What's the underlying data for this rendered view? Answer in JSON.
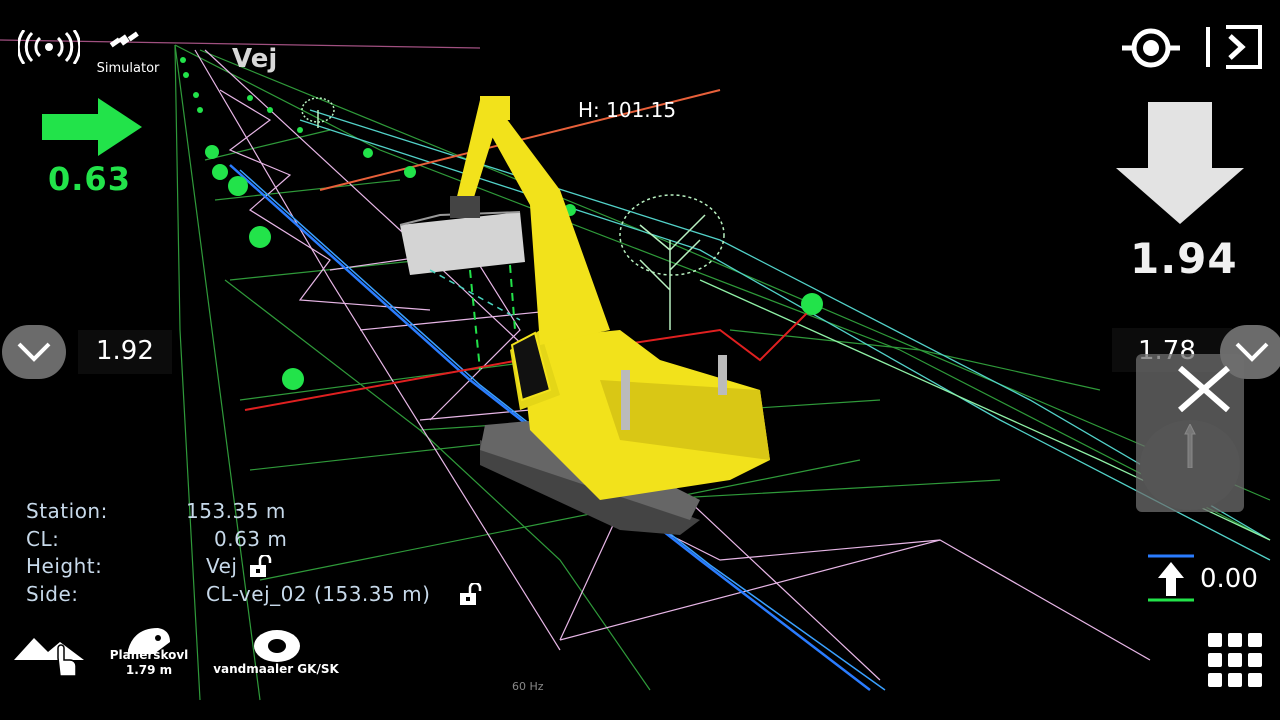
{
  "status": {
    "signal_icon": "radio-signal-icon",
    "satellite_icon": "satellite-icon",
    "mode_label": "Simulator"
  },
  "scene": {
    "surface_label": "Vej",
    "height_marker": "H: 101.15",
    "fps_label": "60 Hz"
  },
  "left_panel": {
    "cl_offset": "0.63",
    "offset_direction": "right",
    "left_edge_value": "1.92"
  },
  "right_panel": {
    "cut_value": "1.94",
    "cut_direction": "down",
    "right_edge_value": "1.78",
    "elevation_offset": "0.00"
  },
  "info": {
    "station_label": "Station:",
    "station_value": "153.35 m",
    "cl_label": "CL:",
    "cl_value": "0.63 m",
    "height_label": "Height:",
    "height_value": "Vej",
    "side_label": "Side:",
    "side_value": "CL-vej_02 (153.35 m)"
  },
  "bottom_toolbar": {
    "terrain_icon": "terrain-touch-icon",
    "bucket_name": "Planerskovl",
    "bucket_width": "1.79 m",
    "sensor_name": "vandmaaler GK/SK",
    "menu_icon": "grid-menu-icon"
  },
  "colors": {
    "accent_green": "#22e34a",
    "excavator_yellow": "#f2e21b",
    "label_blue": "#c7d9ea"
  }
}
